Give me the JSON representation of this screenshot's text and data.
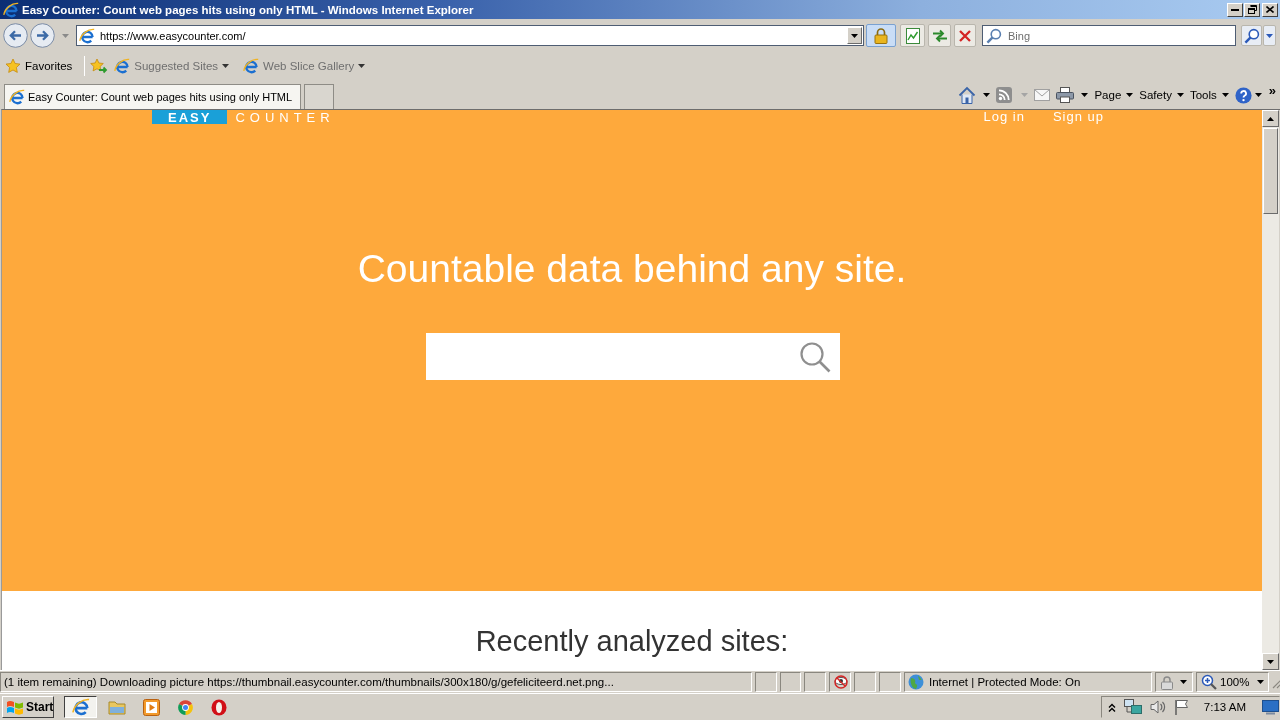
{
  "window": {
    "title": "Easy Counter: Count web pages hits using only HTML - Windows Internet Explorer"
  },
  "address_bar": {
    "url": "https://www.easycounter.com/"
  },
  "search_box": {
    "placeholder": "Bing"
  },
  "favorites_bar": {
    "label": "Favorites",
    "items": [
      {
        "label": "Suggested Sites"
      },
      {
        "label": "Web Slice Gallery"
      }
    ]
  },
  "tabs": [
    {
      "label": "Easy Counter: Count web pages hits using only HTML",
      "selected": true
    }
  ],
  "command_bar": {
    "menus": [
      {
        "label": "Page"
      },
      {
        "label": "Safety"
      },
      {
        "label": "Tools"
      }
    ],
    "overflow": "»"
  },
  "page": {
    "logo": {
      "badge": "EASY",
      "text": "COUNTER"
    },
    "nav": [
      {
        "label": "Log in"
      },
      {
        "label": "Sign up"
      }
    ],
    "headline": "Countable data behind any site.",
    "section_title": "Recently analyzed sites:"
  },
  "status_bar": {
    "message": "(1 item remaining) Downloading picture https://thumbnail.easycounter.com/thumbnails/300x180/g/gefeliciteerd.net.png...",
    "zone": "Internet | Protected Mode: On",
    "zoom": "100%"
  },
  "taskbar": {
    "start": "Start",
    "apps": [
      {
        "kind": "browser",
        "selected": true
      },
      {
        "kind": "folder",
        "selected": false
      },
      {
        "kind": "media",
        "selected": false
      },
      {
        "kind": "chrome",
        "selected": false
      },
      {
        "kind": "opera",
        "selected": false
      }
    ],
    "clock": "7:13 AM"
  }
}
